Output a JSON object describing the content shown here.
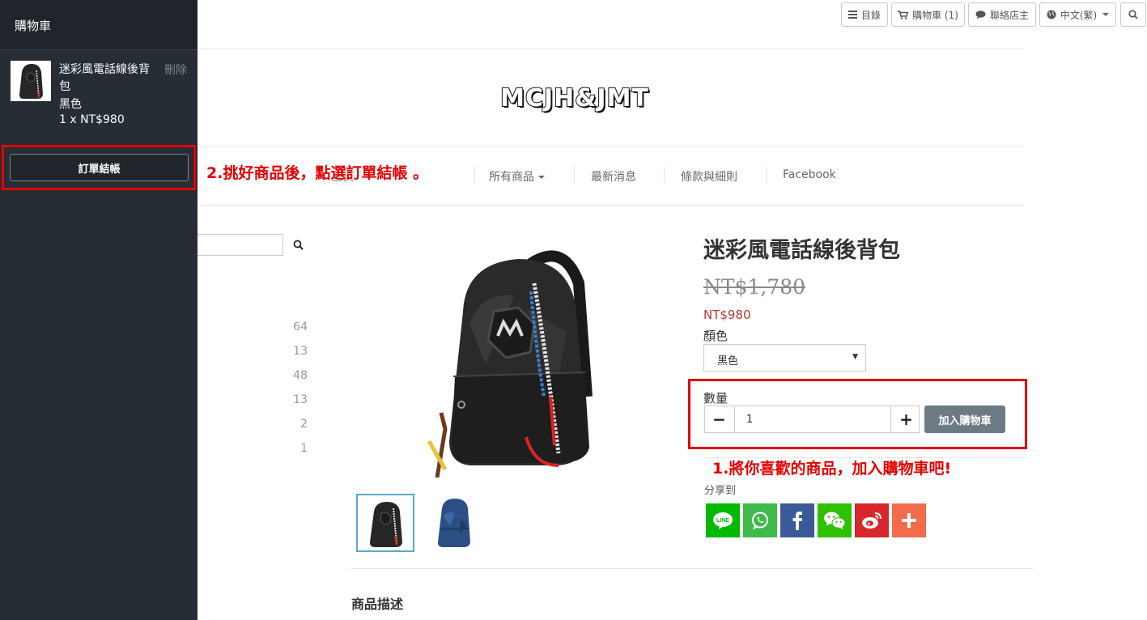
{
  "toolbar": {
    "menu_label": "目錄",
    "cart_label": "購物車 (1)",
    "contact_label": "聯絡店主",
    "language_label": "中文(繁)"
  },
  "brand": {
    "logo_text": "MCJH&JMT"
  },
  "nav": {
    "home": "主頁",
    "all_products": "所有商品",
    "news": "最新消息",
    "terms": "條款與細則",
    "facebook": "Facebook"
  },
  "sidebar_filter": {
    "counts": [
      "64",
      "13",
      "48",
      "13",
      "2",
      "1"
    ]
  },
  "product": {
    "title": "迷彩風電話線後背包",
    "original_price": "NT$1,780",
    "price": "NT$980",
    "color_label": "顏色",
    "color_value": "黑色",
    "qty_label": "數量",
    "qty_value": "1",
    "minus": "−",
    "plus": "+",
    "add_to_cart": "加入購物車",
    "share_label": "分享到",
    "description_title": "商品描述"
  },
  "share": {
    "line_label": "LINE"
  },
  "annotations": {
    "step1": "1.將你喜歡的商品，加入購物車吧!",
    "step2": "2.挑好商品後，點選訂單結帳 。"
  },
  "cart_drawer": {
    "title": "購物車",
    "item": {
      "name": "迷彩風電話線後背包",
      "remove": "刪除",
      "variant": "黑色",
      "qty_price": "1 x  NT$980"
    },
    "checkout": "訂單結帳"
  },
  "colors": {
    "drawer_bg": "#262d35",
    "annotation": "#e30000",
    "sale_price": "#b13a32",
    "add_cart_btn": "#6c7a84",
    "line": "#00b900",
    "whatsapp": "#3fba4a",
    "facebook": "#3b5998",
    "wechat": "#2dc100",
    "weibo": "#d8262d",
    "more": "#f26b4b"
  }
}
